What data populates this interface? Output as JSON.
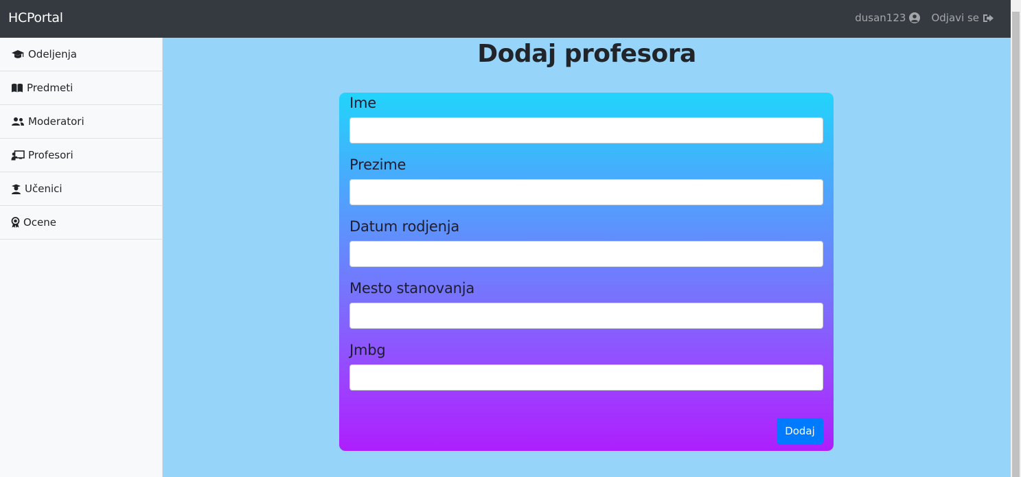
{
  "navbar": {
    "brand": "HCPortal",
    "username": "dusan123",
    "logout_label": "Odjavi se",
    "user_icon": "user-circle-icon",
    "logout_icon": "sign-out-icon"
  },
  "sidebar": {
    "items": [
      {
        "label": "Odeljenja",
        "icon": "graduation-cap-icon"
      },
      {
        "label": "Predmeti",
        "icon": "book-open-icon"
      },
      {
        "label": "Moderatori",
        "icon": "users-icon"
      },
      {
        "label": "Profesori",
        "icon": "chalkboard-teacher-icon"
      },
      {
        "label": "Učenici",
        "icon": "user-graduate-icon"
      },
      {
        "label": "Ocene",
        "icon": "award-icon"
      }
    ]
  },
  "main": {
    "title": "Dodaj profesora",
    "form": {
      "fields": [
        {
          "label": "Ime",
          "value": ""
        },
        {
          "label": "Prezime",
          "value": ""
        },
        {
          "label": "Datum rodjenja",
          "value": ""
        },
        {
          "label": "Mesto stanovanja",
          "value": ""
        },
        {
          "label": "Jmbg",
          "value": ""
        }
      ],
      "submit_label": "Dodaj"
    }
  },
  "colors": {
    "navbar_bg": "#343a40",
    "page_bg": "#97d4fa",
    "sidebar_bg": "#f8f9fa",
    "card_gradient_top": "#22d4fb",
    "card_gradient_bottom": "#ad1ffd",
    "button_primary": "#007bff"
  }
}
